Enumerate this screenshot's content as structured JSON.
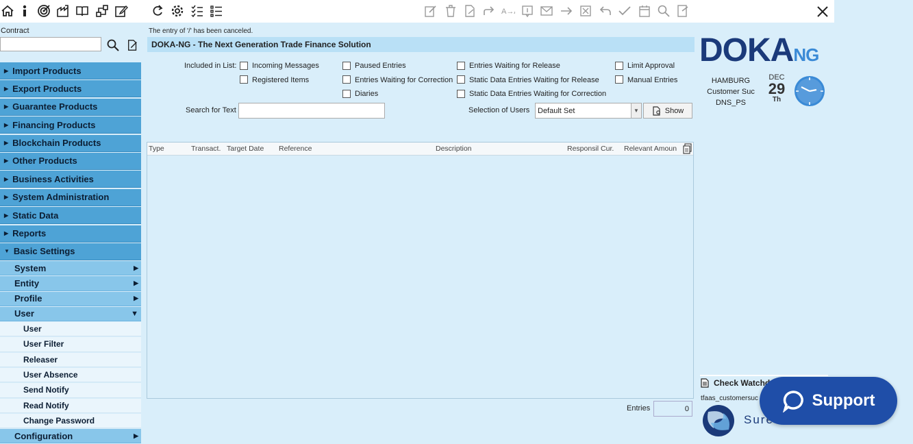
{
  "toolbar": {
    "left_icons": [
      "home-icon",
      "info-icon",
      "target-icon",
      "factory-icon",
      "book-icon",
      "workflow-icon",
      "edit-icon"
    ],
    "mid_icons": [
      "refresh-icon",
      "gear-icon",
      "checklist-icon",
      "list-icon"
    ],
    "action_icons": [
      "edit-doc-icon",
      "trash-icon",
      "attach-icon",
      "forward-icon",
      "swap-icon",
      "info-box-icon",
      "mail-icon",
      "arrow-right-icon",
      "cancel-box-icon",
      "undo-icon",
      "check-icon",
      "calendar-icon",
      "search-icon",
      "export-icon"
    ]
  },
  "contract": {
    "label": "Contract",
    "value": ""
  },
  "sidebar": {
    "groups": [
      {
        "label": "Import Products"
      },
      {
        "label": "Export Products"
      },
      {
        "label": "Guarantee Products"
      },
      {
        "label": "Financing Products"
      },
      {
        "label": "Blockchain Products"
      },
      {
        "label": "Other Products"
      },
      {
        "label": "Business Activities"
      },
      {
        "label": "System Administration"
      },
      {
        "label": "Static Data"
      },
      {
        "label": "Reports"
      },
      {
        "label": "Basic Settings"
      }
    ],
    "sub_items": [
      {
        "label": "System"
      },
      {
        "label": "Entity"
      },
      {
        "label": "Profile"
      },
      {
        "label": "User"
      }
    ],
    "user_items": [
      {
        "label": "User"
      },
      {
        "label": "User Filter"
      },
      {
        "label": "Releaser"
      },
      {
        "label": "User Absence"
      },
      {
        "label": "Send Notify"
      },
      {
        "label": "Read Notify"
      },
      {
        "label": "Change Password"
      }
    ],
    "configuration": {
      "label": "Configuration"
    }
  },
  "status_message": "The entry of '/' has been canceled.",
  "title": "DOKA-NG - The Next Generation Trade Finance Solution",
  "filters": {
    "included_label": "Included in List:",
    "checkboxes": [
      {
        "label": "Incoming Messages",
        "checked": false
      },
      {
        "label": "Registered Items",
        "checked": false
      },
      {
        "label": "Paused Entries",
        "checked": false
      },
      {
        "label": "Entries Waiting for Correction",
        "checked": false
      },
      {
        "label": "Diaries",
        "checked": false
      },
      {
        "label": "Entries Waiting for Release",
        "checked": false
      },
      {
        "label": "Static Data Entries Waiting for Release",
        "checked": false
      },
      {
        "label": "Static Data Entries Waiting for Correction",
        "checked": false
      },
      {
        "label": "Limit Approval",
        "checked": false
      },
      {
        "label": "Manual Entries",
        "checked": false
      }
    ],
    "search_label": "Search for Text",
    "search_value": "",
    "users_label": "Selection of Users",
    "users_value": "Default Set",
    "show_label": "Show"
  },
  "table": {
    "columns": [
      "Type",
      "Transact.",
      "Target Date",
      "Reference",
      "Description",
      "Responsil Cur.",
      "Relevant Amoun"
    ],
    "rows": []
  },
  "entries": {
    "label": "Entries",
    "value": "0"
  },
  "brand": {
    "logo_main": "DOKA",
    "logo_suffix": "NG",
    "location": "HAMBURG",
    "customer": "Customer Suc",
    "user": "DNS_PS",
    "month": "DEC",
    "day": "29",
    "weekday": "Th"
  },
  "watch": {
    "label": "Check Watchd",
    "user": "tfaas_customersuc"
  },
  "sure_text": "Sure",
  "support": {
    "label": "Support"
  },
  "colors": {
    "nav": "#4ea3d6",
    "sub": "#88c6ea",
    "support": "#1f4ea8",
    "logo": "#1b3a7a"
  }
}
